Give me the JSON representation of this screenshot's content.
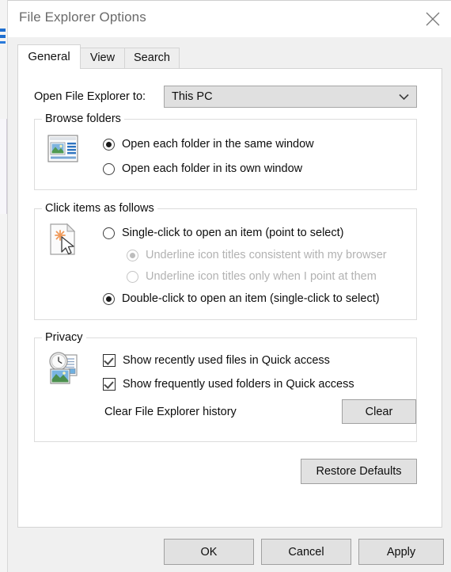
{
  "window": {
    "title": "File Explorer Options",
    "close_icon": "close-icon"
  },
  "tabs": [
    {
      "label": "General",
      "active": true
    },
    {
      "label": "View",
      "active": false
    },
    {
      "label": "Search",
      "active": false
    }
  ],
  "general": {
    "open_to": {
      "label": "Open File Explorer to:",
      "value": "This PC",
      "arrow_icon": "chevron-down-icon"
    },
    "browse_folders": {
      "title": "Browse folders",
      "icon": "window-preview-icon",
      "options": [
        {
          "label": "Open each folder in the same window",
          "checked": true
        },
        {
          "label": "Open each folder in its own window",
          "checked": false
        }
      ]
    },
    "click_items": {
      "title": "Click items as follows",
      "icon": "document-pointer-icon",
      "options": [
        {
          "label": "Single-click to open an item (point to select)",
          "checked": false,
          "disabled": false,
          "indent": false
        },
        {
          "label": "Underline icon titles consistent with my browser",
          "checked": true,
          "disabled": true,
          "indent": true
        },
        {
          "label": "Underline icon titles only when I point at them",
          "checked": false,
          "disabled": true,
          "indent": true
        },
        {
          "label": "Double-click to open an item (single-click to select)",
          "checked": true,
          "disabled": false,
          "indent": false
        }
      ]
    },
    "privacy": {
      "title": "Privacy",
      "icon": "clock-documents-icon",
      "checkboxes": [
        {
          "label": "Show recently used files in Quick access",
          "checked": true
        },
        {
          "label": "Show frequently used folders in Quick access",
          "checked": true
        }
      ],
      "clear_history_label": "Clear File Explorer history",
      "clear_button": "Clear"
    },
    "restore_defaults_button": "Restore Defaults"
  },
  "footer": {
    "ok": "OK",
    "cancel": "Cancel",
    "apply": "Apply"
  },
  "colors": {
    "accent": "#1f6fd0",
    "dialog_bg": "#f0f0f0",
    "panel_bg": "#ffffff",
    "button_bg": "#e1e1e1",
    "disabled_text": "#b2b2b2"
  }
}
